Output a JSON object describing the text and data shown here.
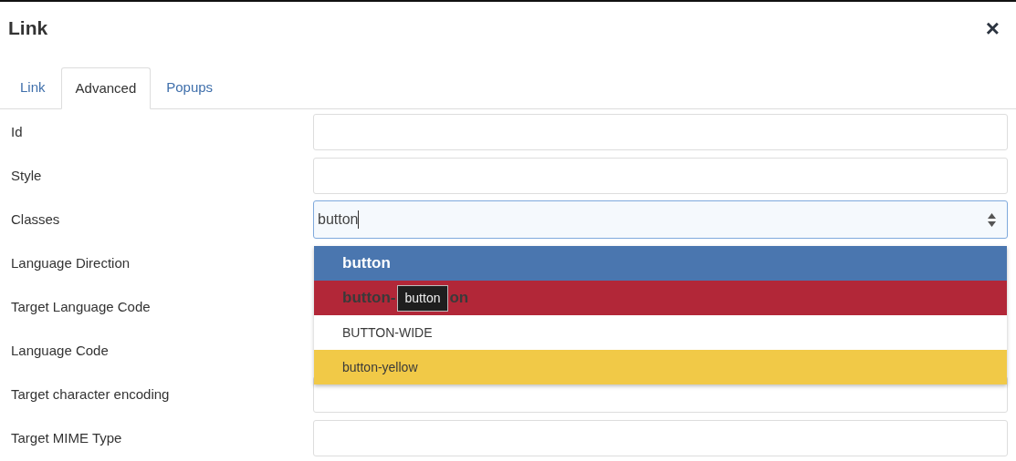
{
  "dialog": {
    "title": "Link",
    "close": "×"
  },
  "tabs": [
    {
      "label": "Link",
      "selected": false
    },
    {
      "label": "Advanced",
      "selected": true
    },
    {
      "label": "Popups",
      "selected": false
    }
  ],
  "fields": [
    {
      "label": "Id",
      "kind": "text"
    },
    {
      "label": "Style",
      "kind": "text"
    },
    {
      "label": "Classes",
      "kind": "combo",
      "value": "button",
      "focused": true
    },
    {
      "label": "Language Direction",
      "kind": "covered"
    },
    {
      "label": "Target Language Code",
      "kind": "covered"
    },
    {
      "label": "Language Code",
      "kind": "covered"
    },
    {
      "label": "Target character encoding",
      "kind": "text"
    },
    {
      "label": "Target MIME Type",
      "kind": "text"
    }
  ],
  "dropdown": {
    "options": [
      {
        "label": "button",
        "selected": true,
        "color": "#4a76af",
        "bold": true
      },
      {
        "label": "button-",
        "label_end": "on",
        "selected": false,
        "color": "#b22738",
        "bold": true,
        "tooltip": "button"
      },
      {
        "label": "BUTTON-WIDE",
        "selected": false,
        "color": "#ffffff",
        "bold": false
      },
      {
        "label": "button-yellow",
        "selected": false,
        "color": "#f1c947",
        "bold": false
      }
    ]
  }
}
